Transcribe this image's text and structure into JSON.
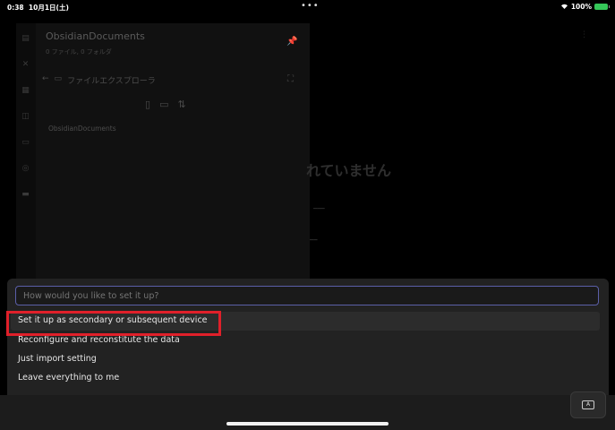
{
  "status_bar": {
    "time": "0:38",
    "date": "10月1日(土)",
    "center_dots": "•••",
    "battery_percent": "100%"
  },
  "sidebar": {
    "vault_name": "ObsidianDocuments",
    "vault_stats": "0 ファイル, 0 フォルダ",
    "explorer_label": "ファイルエクスプローラ",
    "root_folder": "ObsidianDocuments"
  },
  "main": {
    "heading": "れていません"
  },
  "modal": {
    "placeholder": "How would you like to set it up?",
    "options": [
      "Set it up as secondary or subsequent device",
      "Reconfigure and reconstitute the data",
      "Just import setting",
      "Leave everything to me"
    ]
  },
  "colors": {
    "accent_border": "#5b5fa8",
    "highlight_box": "#e0202a",
    "battery": "#35c759"
  }
}
